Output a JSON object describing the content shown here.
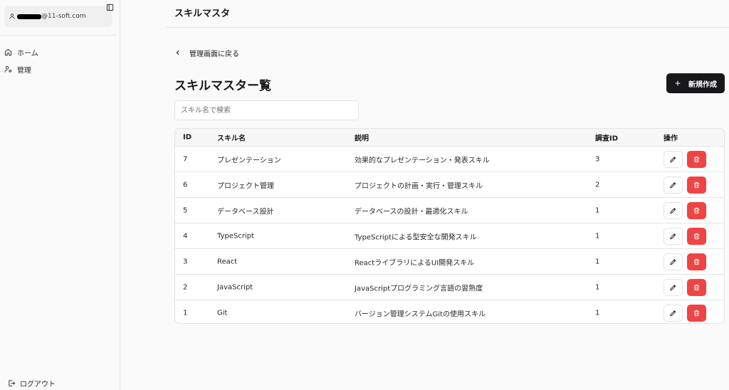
{
  "sidebar": {
    "user_email": "@11-soft.com",
    "nav": [
      {
        "label": "ホーム",
        "icon": "home-icon"
      },
      {
        "label": "管理",
        "icon": "user-cog-icon"
      }
    ],
    "logout_label": "ログアウト"
  },
  "header": {
    "title": "スキルマスタ"
  },
  "main": {
    "back_label": "管理画面に戻る",
    "page_title": "スキルマスター覧",
    "new_button_label": "新規作成",
    "search_placeholder": "スキル名で検索",
    "table": {
      "columns": [
        "ID",
        "スキル名",
        "説明",
        "調査ID",
        "操作"
      ],
      "rows": [
        {
          "id": "7",
          "name": "プレゼンテーション",
          "desc": "効果的なプレゼンテーション・発表スキル",
          "type_id": "3"
        },
        {
          "id": "6",
          "name": "プロジェクト管理",
          "desc": "プロジェクトの計画・実行・管理スキル",
          "type_id": "2"
        },
        {
          "id": "5",
          "name": "データベース設計",
          "desc": "データベースの設計・最適化スキル",
          "type_id": "1"
        },
        {
          "id": "4",
          "name": "TypeScript",
          "desc": "TypeScriptによる型安全な開発スキル",
          "type_id": "1"
        },
        {
          "id": "3",
          "name": "React",
          "desc": "ReactライブラリによるUI開発スキル",
          "type_id": "1"
        },
        {
          "id": "2",
          "name": "JavaScript",
          "desc": "JavaScriptプログラミング言語の習熟度",
          "type_id": "1"
        },
        {
          "id": "1",
          "name": "Git",
          "desc": "バージョン管理システムGitの使用スキル",
          "type_id": "1"
        }
      ]
    }
  },
  "colors": {
    "primary": "#18181b",
    "danger": "#ef4444",
    "border": "#e4e4e7"
  }
}
